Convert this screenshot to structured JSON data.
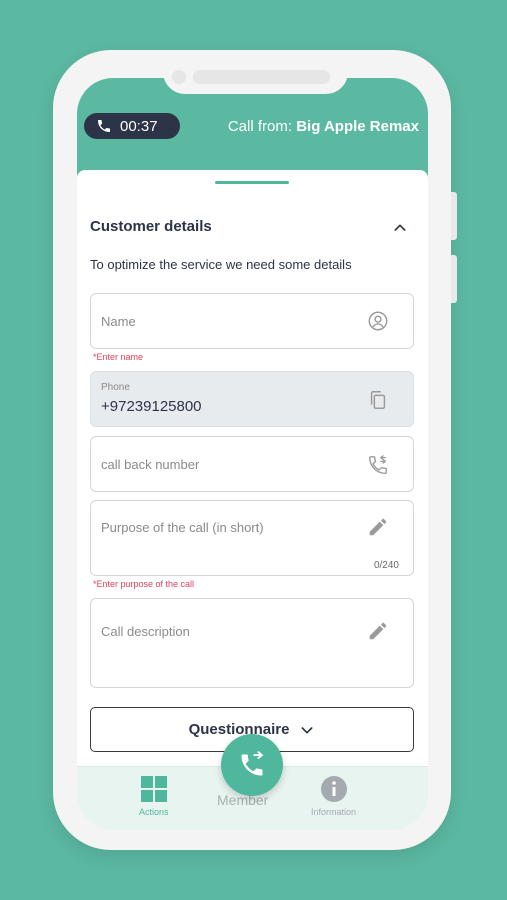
{
  "header": {
    "timer": "00:37",
    "call_from_label": "Call from: ",
    "caller": "Big Apple Remax"
  },
  "customer": {
    "section_title": "Customer details",
    "subtitle": "To optimize the service we need some details",
    "name_placeholder": "Name",
    "name_error": "*Enter name",
    "phone_label": "Phone",
    "phone_value": "+97239125800",
    "callback_placeholder": "call back number",
    "purpose_placeholder": "Purpose of the call (in short)",
    "purpose_counter": "0/240",
    "purpose_error": "*Enter purpose of the call",
    "description_placeholder": "Call description",
    "questionnaire_label": "Questionnaire"
  },
  "nav": {
    "actions": "Actions",
    "center": "Member",
    "information": "Information"
  },
  "colors": {
    "brand": "#5bb8a1",
    "accent": "#4fb89c",
    "error": "#e0425c",
    "dark": "#2d3447"
  },
  "icons": [
    "phone-icon",
    "chevron-up-icon",
    "person-icon",
    "copy-icon",
    "callback-icon",
    "pencil-icon",
    "chevron-down-icon",
    "grid-icon",
    "info-icon",
    "call-transfer-icon"
  ]
}
